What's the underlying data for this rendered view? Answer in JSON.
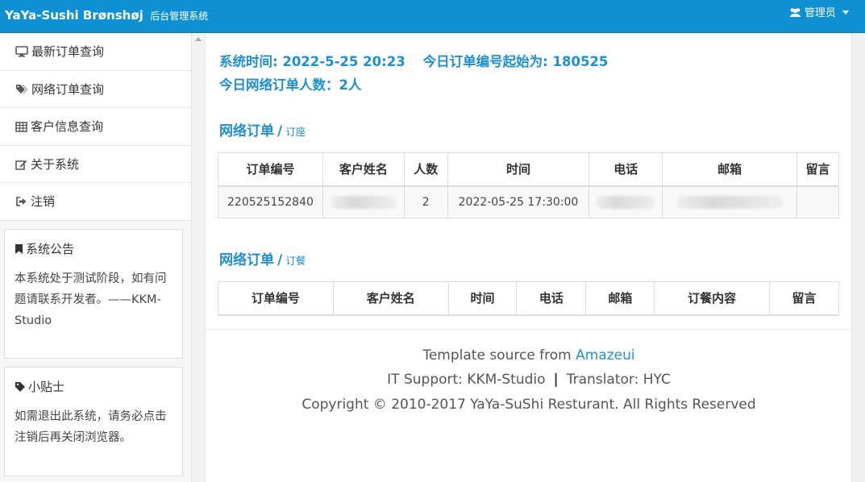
{
  "header": {
    "brand_name": "YaYa-Sushi Brønshøj",
    "brand_sub": "后台管理系统",
    "admin_label": "管理员"
  },
  "sidebar": {
    "nav": [
      {
        "label": "最新订单查询",
        "icon": "monitor-icon"
      },
      {
        "label": "网络订单查询",
        "icon": "tags-icon"
      },
      {
        "label": "客户信息查询",
        "icon": "table-icon"
      },
      {
        "label": "关于系统",
        "icon": "edit-icon"
      },
      {
        "label": "注销",
        "icon": "sign-out-icon"
      }
    ],
    "notice": {
      "title": "系统公告",
      "text": "本系统处于测试阶段，如有问题请联系开发者。——KKM-Studio"
    },
    "tips": {
      "title": "小贴士",
      "text": "如需退出此系统，请务必点击注销后再关闭浏览器。"
    }
  },
  "status": {
    "system_time": "系统时间: 2022-5-25 20:23",
    "order_start": "今日订单编号起始为: 180525",
    "online_count": "今日网络订单人数：2人"
  },
  "reservations": {
    "title": "网络订单",
    "separator": "/",
    "subtitle": "订座",
    "columns": [
      "订单编号",
      "客户姓名",
      "人数",
      "时间",
      "电话",
      "邮箱",
      "留言"
    ],
    "rows": [
      {
        "order_no": "220525152840",
        "name": "",
        "people": "2",
        "time": "2022-05-25 17:30:00",
        "phone": "",
        "email": "",
        "message": ""
      }
    ]
  },
  "food_orders": {
    "title": "网络订单",
    "separator": "/",
    "subtitle": "订餐",
    "columns": [
      "订单编号",
      "客户姓名",
      "时间",
      "电话",
      "邮箱",
      "订餐内容",
      "留言"
    ]
  },
  "footer": {
    "template_prefix": "Template source from",
    "template_link": "Amazeui",
    "it_support": "IT Support: KKM-Studio",
    "divider": "|",
    "translator": "Translator: HYC",
    "copyright": "Copyright © 2010-2017 YaYa-SuShi Resturant. All Rights Reserved"
  },
  "colors": {
    "header_bg": "#0e90d2",
    "accent_text": "#1f8fd0"
  }
}
